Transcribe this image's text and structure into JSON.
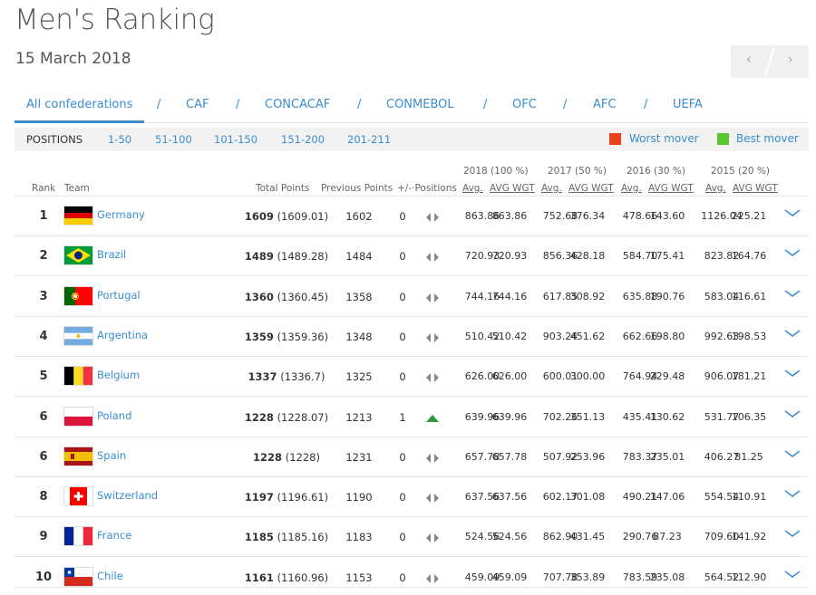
{
  "page": {
    "title": "Men's Ranking",
    "date": "15 March 2018"
  },
  "pager": {
    "prev": "‹",
    "next": "›"
  },
  "tabs": [
    {
      "label": "All confederations",
      "active": true
    },
    {
      "label": "CAF"
    },
    {
      "label": "CONCACAF"
    },
    {
      "label": "CONMEBOL"
    },
    {
      "label": "OFC"
    },
    {
      "label": "AFC"
    },
    {
      "label": "UEFA"
    }
  ],
  "tab_separator": "/",
  "positions": {
    "label": "POSITIONS",
    "ranges": [
      "1-50",
      "51-100",
      "101-150",
      "151-200",
      "201-211"
    ],
    "worst_label": "Worst mover",
    "best_label": "Best mover",
    "worst_color": "#e8431a",
    "best_color": "#58c532"
  },
  "year_headers": [
    "2018 (100 %)",
    "2017 (50 %)",
    "2016 (30 %)",
    "2015 (20 %)"
  ],
  "columns": {
    "rank": "Rank",
    "team": "Team",
    "total": "Total Points",
    "previous": "Previous Points",
    "positions": "+/-·Positions",
    "avg": "Avg.",
    "avg_wgt": "AVG WGT"
  },
  "rows": [
    {
      "rank": "1",
      "team": "Germany",
      "flag": "germany",
      "points": "1609",
      "points_exact": "(1609.01)",
      "previous": "1602",
      "move": "0",
      "move_icon": "unchanged-icon",
      "vals": [
        "863.86",
        "863.86",
        "752.68",
        "376.34",
        "478.66",
        "143.60",
        "1126.04",
        "225.21"
      ]
    },
    {
      "rank": "2",
      "team": "Brazil",
      "flag": "brazil",
      "points": "1489",
      "points_exact": "(1489.28)",
      "previous": "1484",
      "move": "0",
      "move_icon": "unchanged-icon",
      "vals": [
        "720.93",
        "720.93",
        "856.36",
        "428.18",
        "584.70",
        "175.41",
        "823.82",
        "164.76"
      ]
    },
    {
      "rank": "3",
      "team": "Portugal",
      "flag": "portugal",
      "points": "1360",
      "points_exact": "(1360.45)",
      "previous": "1358",
      "move": "0",
      "move_icon": "unchanged-icon",
      "vals": [
        "744.16",
        "744.16",
        "617.85",
        "308.92",
        "635.88",
        "190.76",
        "583.04",
        "116.61"
      ]
    },
    {
      "rank": "4",
      "team": "Argentina",
      "flag": "argentina",
      "points": "1359",
      "points_exact": "(1359.36)",
      "previous": "1348",
      "move": "0",
      "move_icon": "unchanged-icon",
      "vals": [
        "510.42",
        "510.42",
        "903.24",
        "451.62",
        "662.66",
        "198.80",
        "992.63",
        "198.53"
      ]
    },
    {
      "rank": "5",
      "team": "Belgium",
      "flag": "belgium",
      "points": "1337",
      "points_exact": "(1336.7)",
      "previous": "1325",
      "move": "0",
      "move_icon": "unchanged-icon",
      "vals": [
        "626.00",
        "626.00",
        "600.01",
        "300.00",
        "764.94",
        "229.48",
        "906.07",
        "181.21"
      ]
    },
    {
      "rank": "6",
      "team": "Poland",
      "flag": "poland",
      "points": "1228",
      "points_exact": "(1228.07)",
      "previous": "1213",
      "move": "1",
      "move_icon": "up-arrow-icon",
      "vals": [
        "639.96",
        "639.96",
        "702.26",
        "351.13",
        "435.41",
        "130.62",
        "531.77",
        "106.35"
      ]
    },
    {
      "rank": "6",
      "team": "Spain",
      "flag": "spain",
      "points": "1228",
      "points_exact": "(1228)",
      "previous": "1231",
      "move": "0",
      "move_icon": "unchanged-icon",
      "vals": [
        "657.78",
        "657.78",
        "507.92",
        "253.96",
        "783.37",
        "235.01",
        "406.27",
        "81.25"
      ]
    },
    {
      "rank": "8",
      "team": "Switzerland",
      "flag": "switzerland",
      "points": "1197",
      "points_exact": "(1196.61)",
      "previous": "1190",
      "move": "0",
      "move_icon": "unchanged-icon",
      "vals": [
        "637.56",
        "637.56",
        "602.17",
        "301.08",
        "490.21",
        "147.06",
        "554.54",
        "110.91"
      ]
    },
    {
      "rank": "9",
      "team": "France",
      "flag": "france",
      "points": "1185",
      "points_exact": "(1185.16)",
      "previous": "1183",
      "move": "0",
      "move_icon": "unchanged-icon",
      "vals": [
        "524.56",
        "524.56",
        "862.90",
        "431.45",
        "290.76",
        "87.23",
        "709.60",
        "141.92"
      ]
    },
    {
      "rank": "10",
      "team": "Chile",
      "flag": "chile",
      "points": "1161",
      "points_exact": "(1160.96)",
      "previous": "1153",
      "move": "0",
      "move_icon": "unchanged-icon",
      "vals": [
        "459.09",
        "459.09",
        "707.78",
        "353.89",
        "783.59",
        "235.08",
        "564.52",
        "112.90"
      ]
    }
  ]
}
